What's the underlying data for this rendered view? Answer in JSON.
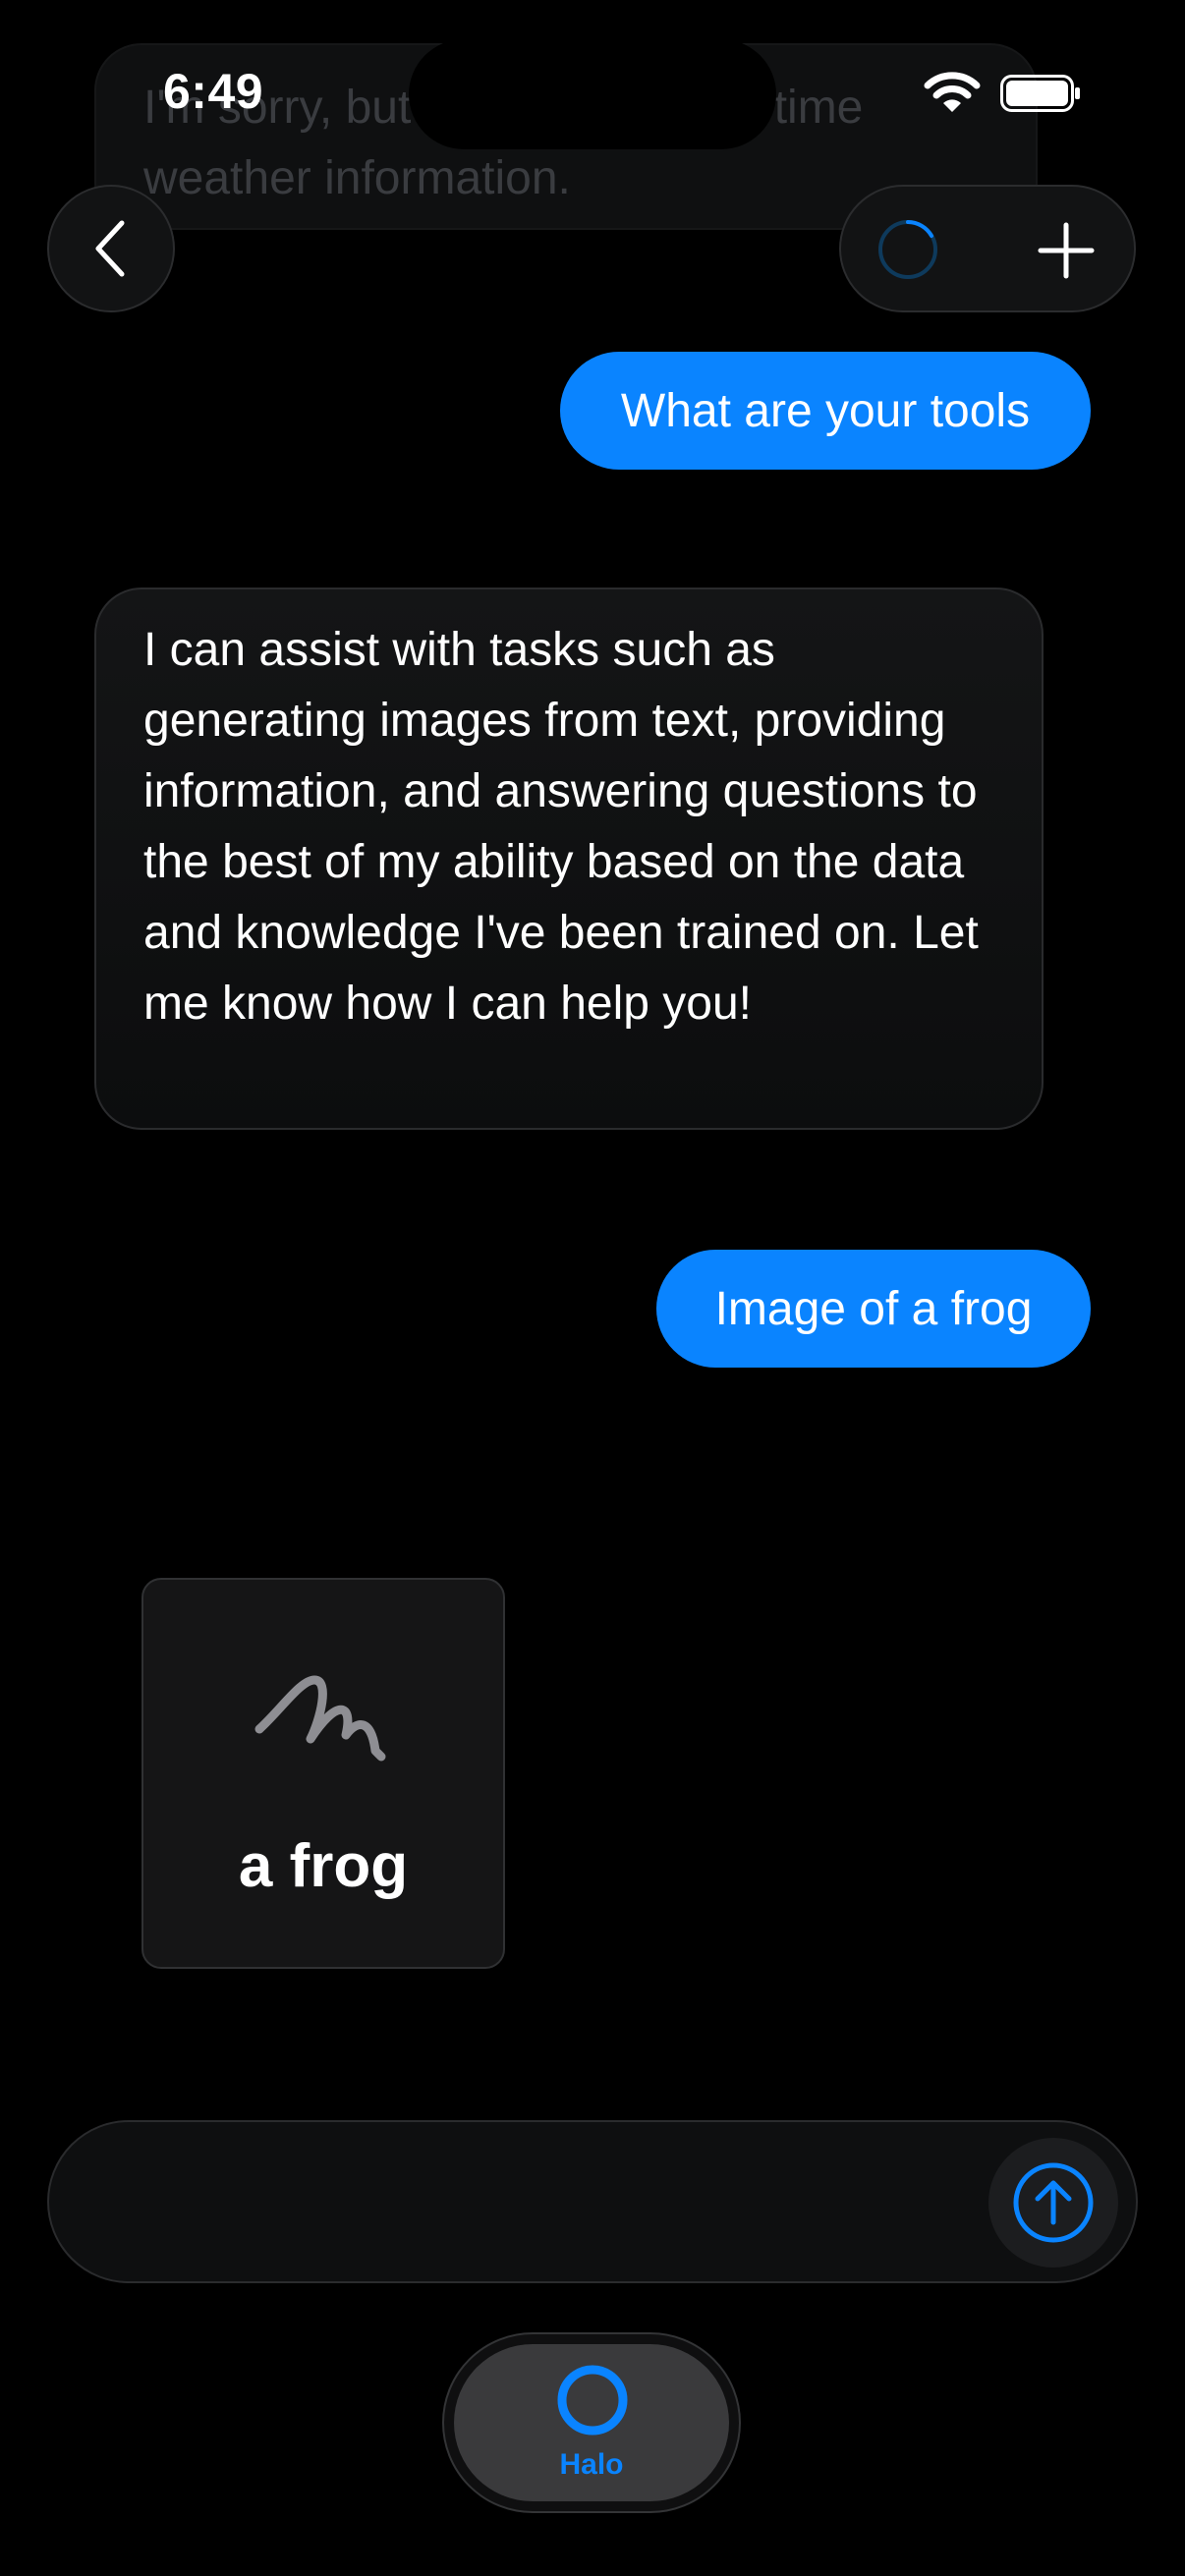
{
  "status_bar": {
    "time": "6:49"
  },
  "previous_message": {
    "text": "I'm sorry, but I don't have real-time weather information."
  },
  "messages": [
    {
      "role": "user",
      "text": "What are your tools"
    },
    {
      "role": "assistant",
      "text": "I can assist with tasks such as generating images from text, providing information, and answering questions to the best of my ability based on the data and knowledge I've been trained on. Let me know how I can help you!"
    },
    {
      "role": "user",
      "text": "Image of a frog"
    }
  ],
  "generated_image": {
    "caption": "a frog",
    "icon": "scribble-icon"
  },
  "input": {
    "value": "",
    "placeholder": ""
  },
  "tab_bar": {
    "active_tab_label": "Halo"
  },
  "icons": {
    "back": "chevron-left-icon",
    "loading": "spinner-icon",
    "new_chat": "plus-icon",
    "send": "arrow-up-circle-icon",
    "tab": "halo-ring-icon"
  },
  "colors": {
    "accent": "#0a84ff",
    "background": "#000000",
    "assistant_bubble": "#141516"
  }
}
